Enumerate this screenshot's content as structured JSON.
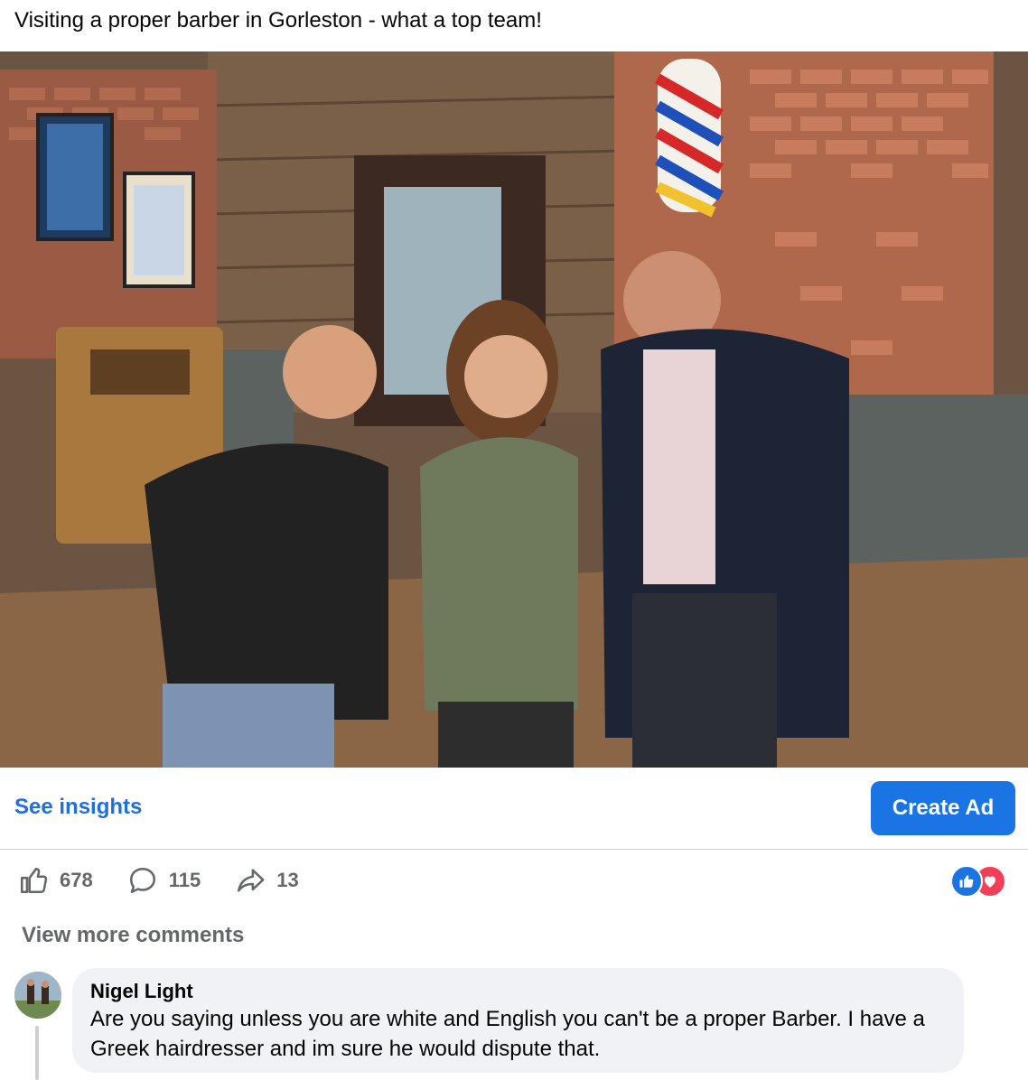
{
  "post": {
    "text": "Visiting a proper barber in Gorleston - what a top team!"
  },
  "actions": {
    "see_insights": "See insights",
    "create_ad": "Create Ad"
  },
  "stats": {
    "likes": "678",
    "comments": "115",
    "shares": "13"
  },
  "reactions": [
    "like",
    "love"
  ],
  "comments_section": {
    "view_more": "View more comments",
    "comment": {
      "author": "Nigel Light",
      "text": "Are you saying unless you are white and English you can't be a proper Barber. I have a Greek hairdresser and im sure he would dispute that."
    }
  },
  "colors": {
    "accent_blue": "#1b74e4",
    "link_blue": "#216fdb",
    "muted_text": "#65676b",
    "love_red": "#f33e58",
    "bubble_bg": "#f0f2f5"
  }
}
